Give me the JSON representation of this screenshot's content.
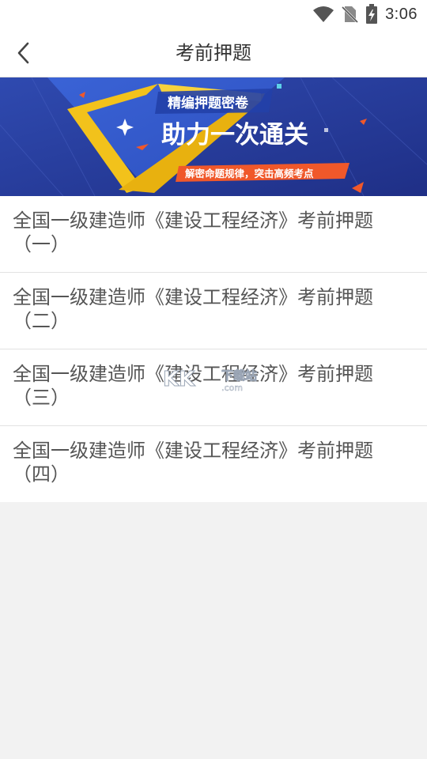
{
  "status_bar": {
    "time": "3:06",
    "icons": [
      "wifi-icon",
      "no-sim-icon",
      "battery-charging-icon"
    ]
  },
  "header": {
    "title": "考前押题",
    "back_icon": "chevron-left-icon"
  },
  "banner": {
    "headline_small": "精编押题密卷",
    "headline_large": "助力一次通关",
    "tagline": "解密命题规律，突击高频考点",
    "colors": {
      "background": "#2b3f9e",
      "ribbon": "#f2c21b",
      "tagline_bg": "#f0582a"
    }
  },
  "exam_list": {
    "items": [
      {
        "title": "全国一级建造师《建设工程经济》考前押题（一）"
      },
      {
        "title": "全国一级建造师《建设工程经济》考前押题（二）"
      },
      {
        "title": "全国一级建造师《建设工程经济》考前押题（三）"
      },
      {
        "title": "全国一级建造师《建设工程经济》考前押题（四）"
      }
    ]
  },
  "watermark": {
    "logo": "KK",
    "text": "下载站",
    "sub": ".com"
  }
}
